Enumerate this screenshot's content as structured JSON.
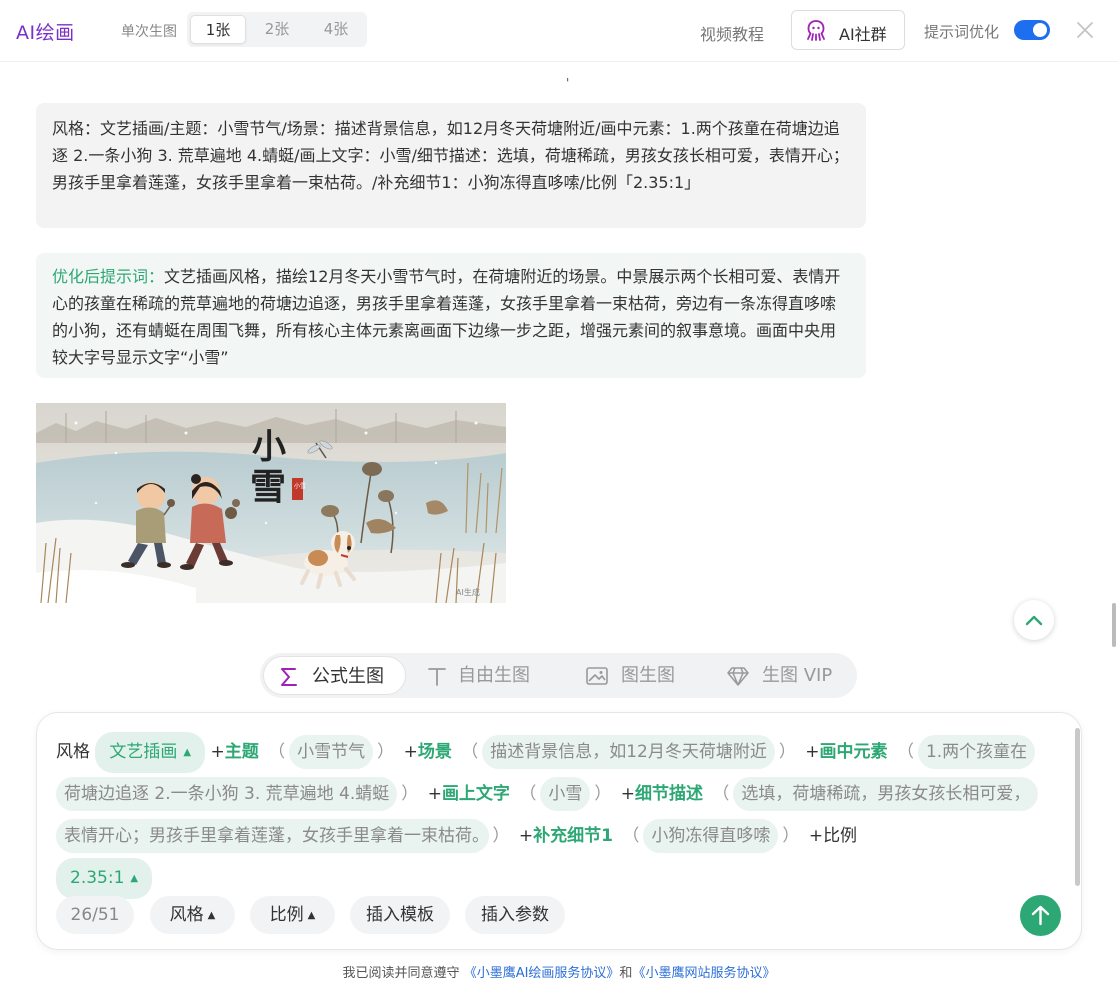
{
  "header": {
    "brand": "AI绘画",
    "count_label": "单次生图",
    "count_options": [
      "1张",
      "2张",
      "4张"
    ],
    "count_selected": "1张",
    "video_tutorial": "视频教程",
    "community": "AI社群",
    "prompt_opt_label": "提示词优化",
    "prompt_opt_enabled": true
  },
  "chat": {
    "dot": "'",
    "user_prompt": "风格：文艺插画/主题：小雪节气/场景：描述背景信息，如12月冬天荷塘附近/画中元素：1.两个孩童在荷塘边追逐 2.一条小狗 3. 荒草遍地 4.蜻蜓/画上文字：小雪/细节描述：选填，荷塘稀疏，男孩女孩长相可爱，表情开心；男孩手里拿着莲蓬，女孩手里拿着一束枯荷。/补充细节1：小狗冻得直哆嗦/比例「2.35:1」",
    "optimized_prefix": "优化后提示词：",
    "optimized_text": "文艺插画风格，描绘12月冬天小雪节气时，在荷塘附近的场景。中景展示两个长相可爱、表情开心的孩童在稀疏的荒草遍地的荷塘边追逐，男孩手里拿着莲蓬，女孩手里拿着一束枯荷，旁边有一条冻得直哆嗦的小狗，还有蜻蜓在周围飞舞，所有核心主体元素离画面下边缘一步之距，增强元素间的叙事意境。画面中央用较大字号显示文字“小雪”",
    "image": {
      "title_char_1": "小",
      "title_char_2": "雪",
      "seal": "小雪",
      "watermark": "AI生成"
    }
  },
  "modes": [
    {
      "label": "公式生图",
      "icon": "sigma-icon",
      "active": true
    },
    {
      "label": "自由生图",
      "icon": "text-t-icon",
      "active": false
    },
    {
      "label": "图生图",
      "icon": "image-icon",
      "active": false
    },
    {
      "label": "生图 VIP",
      "icon": "diamond-icon",
      "active": false
    }
  ],
  "composer": {
    "style_label": "风格",
    "style_value": "文艺插画",
    "theme_key": "主题",
    "theme_value": "小雪节气",
    "scene_key": "场景",
    "scene_value": "描述背景信息，如12月冬天荷塘附近",
    "elements_key": "画中元素",
    "elements_value": "1.两个孩童在荷塘边追逐 2.一条小狗 3. 荒草遍地 4.蜻蜓",
    "text_key": "画上文字",
    "text_value": "小雪",
    "detail_key": "细节描述",
    "detail_value": "选填，荷塘稀疏，男孩女孩长相可爱，表情开心；男孩手里拿着莲蓬，女孩手里拿着一束枯荷。",
    "extra_key": "补充细节1",
    "extra_value": "小狗冻得直哆嗦",
    "ratio_label": "比例",
    "ratio_value": "2.35:1",
    "plus": "+",
    "lparen": "（",
    "rparen": "）"
  },
  "toolbar": {
    "counter": "26/51",
    "style": "风格",
    "ratio": "比例",
    "insert_template": "插入模板",
    "insert_param": "插入参数"
  },
  "agreement": {
    "prefix": "我已阅读并同意遵守",
    "link1": "《小墨鹰AI绘画服务协议》",
    "and": "和",
    "link2": "《小墨鹰网站服务协议》"
  },
  "colors": {
    "brand": "#7b2fc9",
    "accent": "#2da874",
    "toggle": "#1e6ef0",
    "link": "#2c6fd6"
  }
}
